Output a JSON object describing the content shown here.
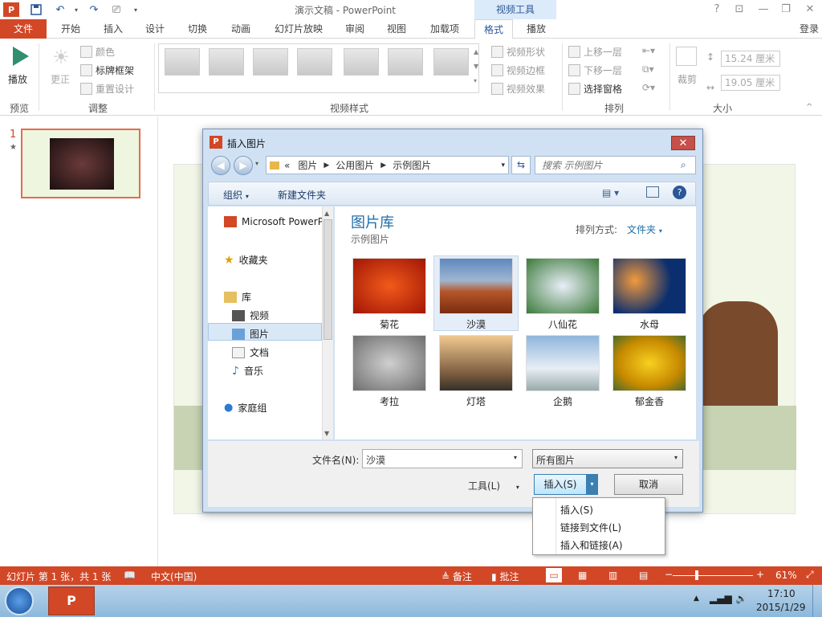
{
  "window": {
    "title": "演示文稿 - PowerPoint",
    "context_group": "视频工具",
    "account": "登录"
  },
  "quick_access": {
    "app_icon": "P",
    "help": "?",
    "minimize": "—",
    "restore": "❐",
    "close": "✕",
    "ribbon_display": "⊡"
  },
  "tabs": [
    {
      "label": "文件"
    },
    {
      "label": "开始"
    },
    {
      "label": "插入"
    },
    {
      "label": "设计"
    },
    {
      "label": "切换"
    },
    {
      "label": "动画"
    },
    {
      "label": "幻灯片放映"
    },
    {
      "label": "审阅"
    },
    {
      "label": "视图"
    },
    {
      "label": "加载项"
    },
    {
      "label": "格式"
    },
    {
      "label": "播放"
    }
  ],
  "ribbon": {
    "preview": {
      "play": "播放",
      "group": "预览"
    },
    "adjust": {
      "correct": "更正",
      "color": "颜色",
      "poster_frame": "标牌框架",
      "reset_design": "重置设计",
      "group": "调整"
    },
    "video_styles": {
      "group": "视频样式",
      "shape": "视频形状",
      "border": "视频边框",
      "effects": "视频效果"
    },
    "arrange": {
      "bring_forward": "上移一层",
      "send_backward": "下移一层",
      "selection_pane": "选择窗格",
      "group": "排列"
    },
    "size": {
      "crop": "裁剪",
      "height": "15.24 厘米",
      "width": "19.05 厘米",
      "group": "大小"
    }
  },
  "slides_pane": {
    "number": "1",
    "star": "★"
  },
  "dialog": {
    "title": "插入图片",
    "close": "✕",
    "breadcrumb": {
      "prefix": "«",
      "parts": [
        "图片",
        "公用图片",
        "示例图片"
      ]
    },
    "search_placeholder": "搜索 示例图片",
    "toolbar": {
      "organize": "组织",
      "new_folder": "新建文件夹"
    },
    "nav": {
      "microsoft": "Microsoft PowerP",
      "favorites": "收藏夹",
      "library": "库",
      "videos": "视频",
      "pictures": "图片",
      "documents": "文档",
      "music": "音乐",
      "homegroup": "家庭组"
    },
    "library_title": "图片库",
    "library_subtitle": "示例图片",
    "arrange_by_label": "排列方式:",
    "arrange_by_value": "文件夹",
    "photos": [
      {
        "label": "菊花"
      },
      {
        "label": "沙漠"
      },
      {
        "label": "八仙花"
      },
      {
        "label": "水母"
      },
      {
        "label": "考拉"
      },
      {
        "label": "灯塔"
      },
      {
        "label": "企鹅"
      },
      {
        "label": "郁金香"
      }
    ],
    "filename_label": "文件名(N):",
    "filename_value": "沙漠",
    "filetype_value": "所有图片",
    "tools_label": "工具(L)",
    "insert_button": "插入(S)",
    "cancel_button": "取消",
    "insert_menu": [
      "插入(S)",
      "链接到文件(L)",
      "插入和链接(A)"
    ]
  },
  "statusbar": {
    "slide_info": "幻灯片 第 1 张，共 1 张",
    "language": "中文(中国)",
    "notes": "备注",
    "comments": "批注",
    "zoom": "61%"
  },
  "taskbar": {
    "time": "17:10",
    "date": "2015/1/29",
    "app_badge": "P"
  }
}
